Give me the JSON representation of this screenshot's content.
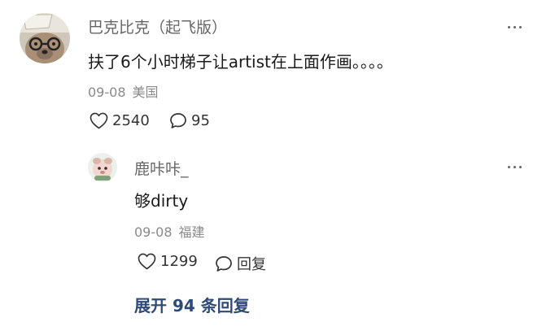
{
  "main_comment": {
    "username": "巴克比克（起飞版）",
    "content": "扶了6个小时梯子让artist在上面作画。。。。",
    "date": "09-08",
    "location": "美国",
    "like_count": "2540",
    "reply_count": "95",
    "more_icon": "more-horizontal-icon",
    "like_icon": "heart-outline-icon",
    "reply_icon": "chat-bubble-icon"
  },
  "reply_comment": {
    "username": "鹿咔咔_",
    "content": "够dirty",
    "date": "09-08",
    "location": "福建",
    "like_count": "1299",
    "reply_label": "回复",
    "more_icon": "more-horizontal-icon",
    "like_icon": "heart-outline-icon",
    "reply_icon": "chat-bubble-icon"
  },
  "expand_replies": {
    "label": "展开 94 条回复"
  },
  "colors": {
    "username": "#666666",
    "meta": "#8a8a8a",
    "expand_link": "#2e4a76",
    "text": "#1a1a1a"
  }
}
